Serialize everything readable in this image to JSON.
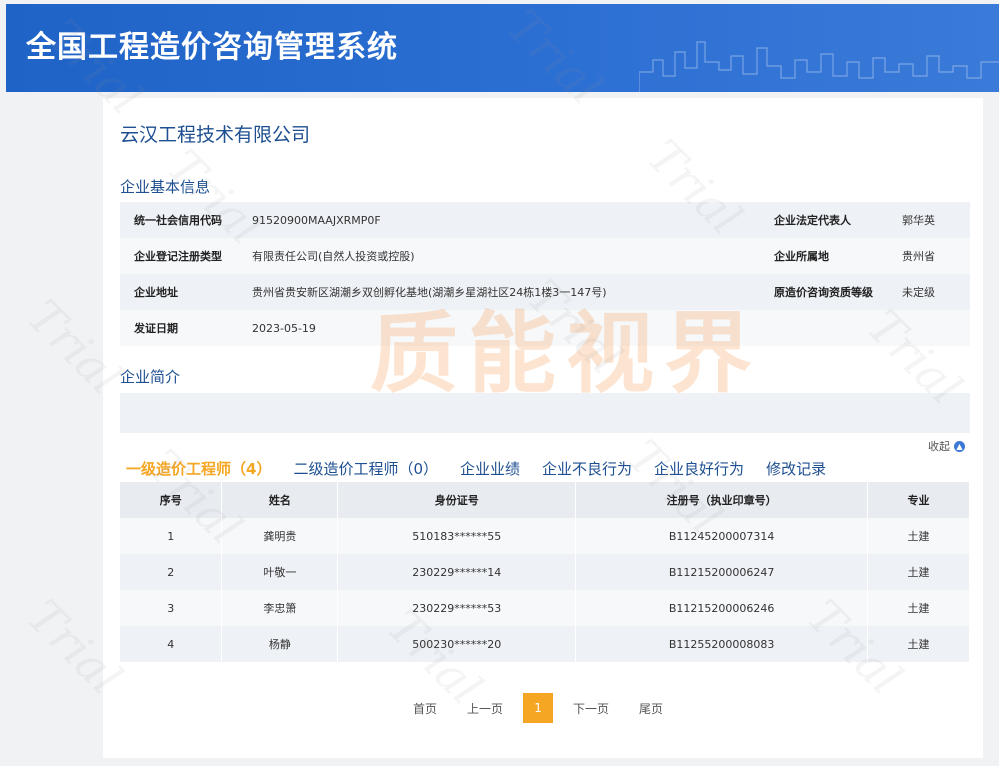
{
  "header": {
    "title": "全国工程造价咨询管理系统"
  },
  "company": {
    "name": "云汉工程技术有限公司"
  },
  "basic_info": {
    "section_title": "企业基本信息",
    "rows": [
      {
        "label1": "统一社会信用代码",
        "value1": "91520900MAAJXRMP0F",
        "label2": "企业法定代表人",
        "value2": "郭华英"
      },
      {
        "label1": "企业登记注册类型",
        "value1": "有限责任公司(自然人投资或控股)",
        "label2": "企业所属地",
        "value2": "贵州省"
      },
      {
        "label1": "企业地址",
        "value1": "贵州省贵安新区湖潮乡双创孵化基地(湖潮乡星湖社区24栋1楼3一147号)",
        "label2": "原造价咨询资质等级",
        "value2": "未定级"
      },
      {
        "label1": "发证日期",
        "value1": "2023-05-19",
        "label2": "",
        "value2": ""
      }
    ]
  },
  "intro": {
    "section_title": "企业简介",
    "collapse_label": "收起"
  },
  "tabs": [
    {
      "label": "一级造价工程师",
      "count": "（4）"
    },
    {
      "label": "二级造价工程师",
      "count": "（0）"
    },
    {
      "label": "企业业绩",
      "count": ""
    },
    {
      "label": "企业不良行为",
      "count": ""
    },
    {
      "label": "企业良好行为",
      "count": ""
    },
    {
      "label": "修改记录",
      "count": ""
    }
  ],
  "table": {
    "headers": [
      "序号",
      "姓名",
      "身份证号",
      "注册号（执业印章号）",
      "专业"
    ],
    "rows": [
      [
        "1",
        "龚明贵",
        "510183******55",
        "B11245200007314",
        "土建"
      ],
      [
        "2",
        "叶敬一",
        "230229******14",
        "B11215200006247",
        "土建"
      ],
      [
        "3",
        "李忠箫",
        "230229******53",
        "B11215200006246",
        "土建"
      ],
      [
        "4",
        "杨静",
        "500230******20",
        "B11255200008083",
        "土建"
      ]
    ]
  },
  "pager": {
    "first": "首页",
    "prev": "上一页",
    "current": "1",
    "next": "下一页",
    "last": "尾页"
  },
  "watermark": {
    "big": "质能视界",
    "trial": "Trial"
  },
  "colors": {
    "header_blue": "#1f63c7",
    "link_blue": "#1d4f91",
    "accent_orange": "#f5a623"
  }
}
